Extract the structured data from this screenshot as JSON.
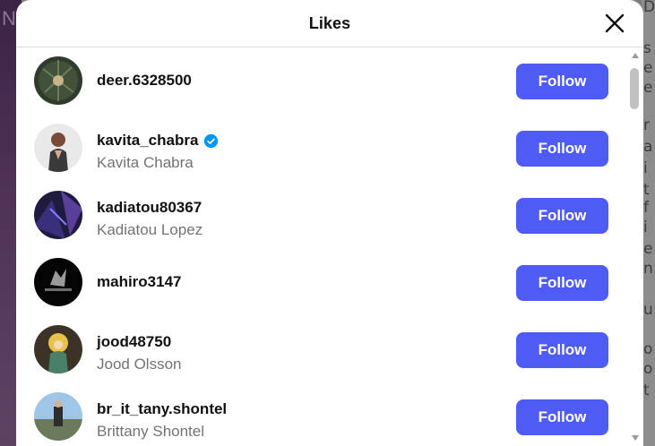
{
  "dialog": {
    "title": "Likes",
    "close_icon": "close-icon"
  },
  "likes": [
    {
      "username": "deer.6328500",
      "fullname": "",
      "verified": false,
      "button": "Follow"
    },
    {
      "username": "kavita_chabra",
      "fullname": "Kavita Chabra",
      "verified": true,
      "button": "Follow"
    },
    {
      "username": "kadiatou80367",
      "fullname": "Kadiatou Lopez",
      "verified": false,
      "button": "Follow"
    },
    {
      "username": "mahiro3147",
      "fullname": "",
      "verified": false,
      "button": "Follow"
    },
    {
      "username": "jood48750",
      "fullname": "Jood Olsson",
      "verified": false,
      "button": "Follow"
    },
    {
      "username": "br_it_tany.shontel",
      "fullname": "Brittany Shontel",
      "verified": false,
      "button": "Follow"
    }
  ],
  "colors": {
    "follow_button": "#4f5bf5",
    "verified_badge": "#0095f6"
  }
}
